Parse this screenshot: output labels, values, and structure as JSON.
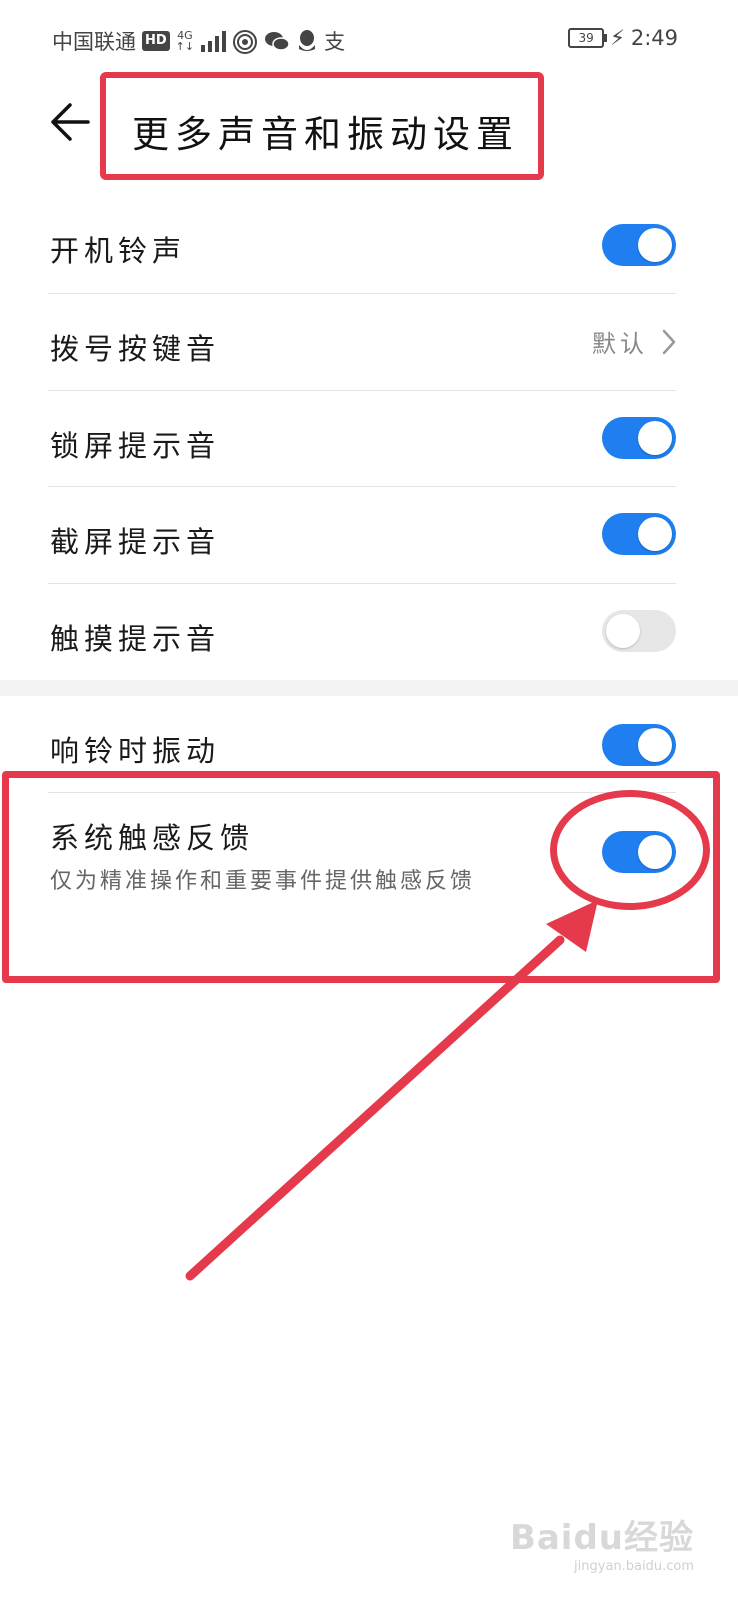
{
  "status_bar": {
    "carrier": "中国联通",
    "hd": "HD",
    "network": "4G",
    "alipay_glyph": "支",
    "battery": "39",
    "time": "2:49"
  },
  "header": {
    "back_icon": "arrow-left-icon",
    "title": "更多声音和振动设置"
  },
  "settings": [
    {
      "label": "开机铃声",
      "type": "toggle",
      "state": "on"
    },
    {
      "label": "拨号按键音",
      "type": "value",
      "value": "默认"
    },
    {
      "label": "锁屏提示音",
      "type": "toggle",
      "state": "on"
    },
    {
      "label": "截屏提示音",
      "type": "toggle",
      "state": "on"
    },
    {
      "label": "触摸提示音",
      "type": "toggle",
      "state": "off"
    }
  ],
  "settings2": [
    {
      "label": "响铃时振动",
      "type": "toggle",
      "state": "on"
    },
    {
      "label": "系统触感反馈",
      "sub": "仅为精准操作和重要事件提供触感反馈",
      "type": "toggle",
      "state": "on"
    }
  ],
  "colors": {
    "accent": "#1f7ef0",
    "annotation": "#e43a4b",
    "toggle_off": "#e6e6e6"
  },
  "watermark": {
    "main": "Baidu经验",
    "sub": "jingyan.baidu.com"
  }
}
